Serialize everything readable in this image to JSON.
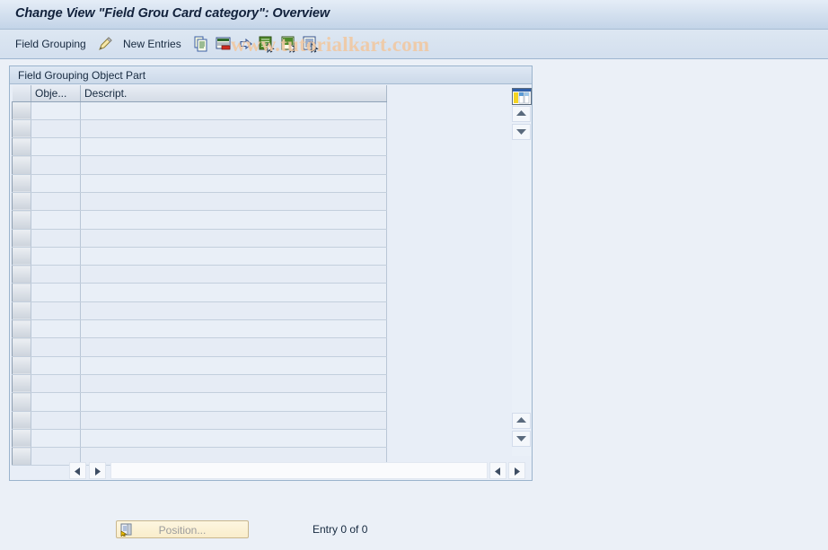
{
  "window": {
    "title": "Change View \"Field Grou Card category\": Overview"
  },
  "toolbar": {
    "field_grouping_label": "Field Grouping",
    "pencil_icon": "pencil-icon",
    "new_entries_label": "New Entries",
    "icons": [
      {
        "name": "copy-icon",
        "title": "Copy As..."
      },
      {
        "name": "delete-row-icon",
        "title": "Delete"
      },
      {
        "name": "undo-icon",
        "title": "Undo Change"
      },
      {
        "name": "select-all-icon",
        "title": "Select All"
      },
      {
        "name": "deselect-all-icon",
        "title": "Deselect All"
      },
      {
        "name": "select-block-icon",
        "title": "Select Block"
      }
    ]
  },
  "watermark": {
    "text": "www.tutorialkart.com"
  },
  "panel": {
    "header": "Field Grouping Object Part"
  },
  "table": {
    "columns": [
      {
        "name": "row-selector",
        "label": ""
      },
      {
        "name": "object",
        "label": "Obje..."
      },
      {
        "name": "description",
        "label": "Descript."
      }
    ],
    "rows": [],
    "row_count": 20,
    "config_icon": "table-settings-icon"
  },
  "scroll": {
    "vertical_up_icon": "triangle-up-icon",
    "vertical_down_icon": "triangle-down-icon",
    "horizontal_left_icon": "triangle-left-icon",
    "horizontal_right_icon": "triangle-right-icon"
  },
  "footer": {
    "position_button_label": "Position...",
    "position_button_icon": "position-icon",
    "entry_count": "Entry 0 of 0"
  },
  "colors": {
    "title_bar": "#d2dfee",
    "toolbar": "#d3dfee",
    "page_background": "#ebf0f7",
    "panel_border": "#9bb4cd",
    "row_light": "#e9eff7",
    "row_alt": "#e6ecf5",
    "watermark": "#f0c9a4",
    "position_button": "#f9edcb"
  }
}
